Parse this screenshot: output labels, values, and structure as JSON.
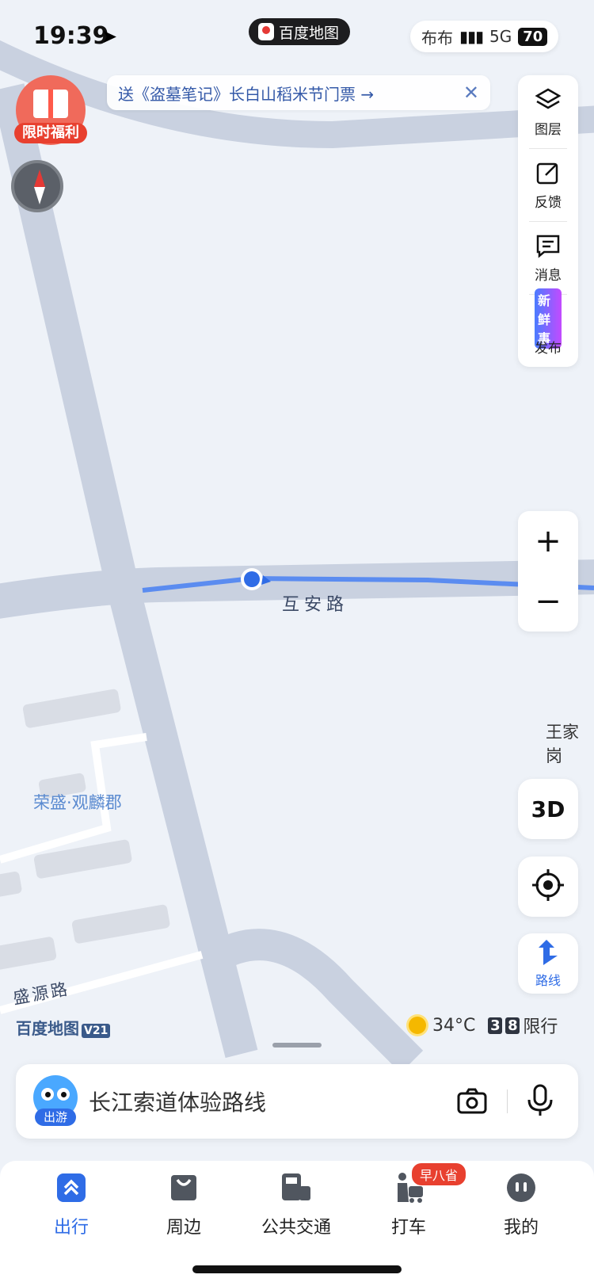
{
  "status_bar": {
    "time": "19:39",
    "app_pill": "百度地图",
    "right_text": "布布",
    "network": "5G",
    "battery": "70"
  },
  "banner": {
    "text": "送《盗墓笔记》长白山稻米节门票 →"
  },
  "welfare": {
    "label": "限时福利"
  },
  "tools": [
    {
      "icon": "layers-icon",
      "label": "图层"
    },
    {
      "icon": "feedback-icon",
      "label": "反馈"
    },
    {
      "icon": "message-icon",
      "label": "消息"
    },
    {
      "icon": "publish-icon",
      "label": "发布",
      "tag": "新鲜事"
    }
  ],
  "zoom": {
    "plus": "+",
    "minus": "−"
  },
  "view_3d": "3D",
  "route_label": "路线",
  "map_labels": {
    "road_main": "互安路",
    "place_estate": "荣盛·观麟郡",
    "place_village": "王家岗",
    "road_secondary": "盛源路"
  },
  "brand": {
    "name": "百度地图",
    "version": "V21"
  },
  "weather": {
    "temp": "34°C",
    "limit_digits": [
      "3",
      "8"
    ],
    "limit_label": "限行"
  },
  "search": {
    "mascot_tag": "出游",
    "query": "长江索道体验路线"
  },
  "nav": [
    {
      "label": "出行",
      "icon": "travel-icon",
      "active": true
    },
    {
      "label": "周边",
      "icon": "nearby-icon",
      "active": false
    },
    {
      "label": "公共交通",
      "icon": "transit-icon",
      "active": false
    },
    {
      "label": "打车",
      "icon": "taxi-icon",
      "active": false,
      "badge": "早八省"
    },
    {
      "label": "我的",
      "icon": "profile-icon",
      "active": false
    }
  ],
  "colors": {
    "accent": "#2f6ce6",
    "route": "#5b8cf0",
    "road": "#c9d1e0",
    "map_bg": "#eef2f8"
  }
}
